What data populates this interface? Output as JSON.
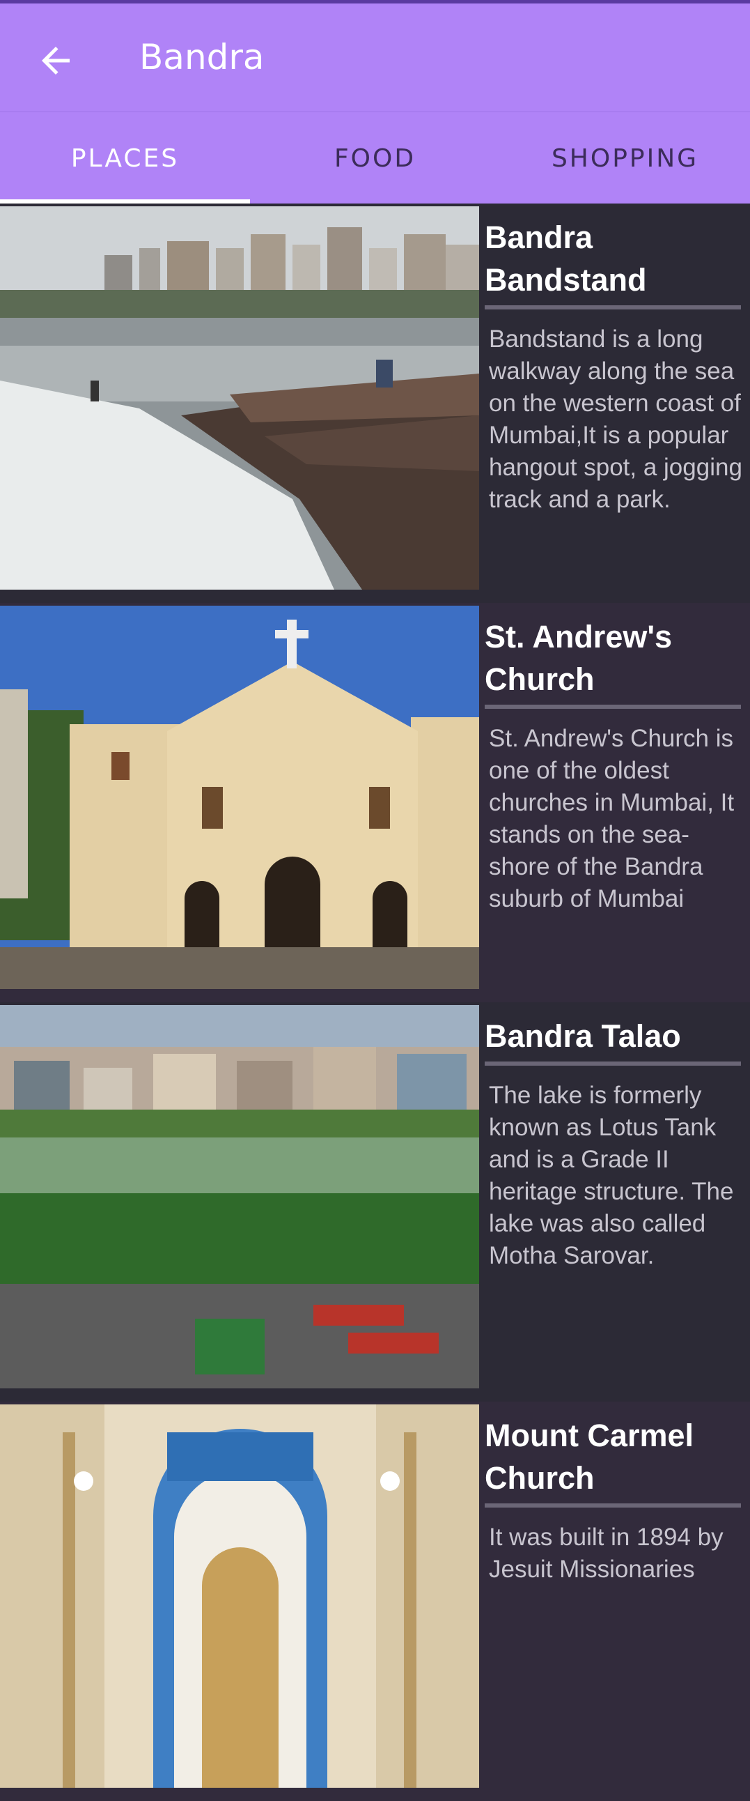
{
  "app_bar": {
    "title": "Bandra",
    "back_icon": "arrow-left-icon"
  },
  "tabs": [
    {
      "label": "PLACES"
    },
    {
      "label": "FOOD"
    },
    {
      "label": "SHOPPING"
    }
  ],
  "places": [
    {
      "name": "Bandra Bandstand",
      "description": "Bandstand is a long walkway along the sea on the western coast of Mumbai,It is a popular hangout spot, a jogging track and a park."
    },
    {
      "name": "St. Andrew's Church",
      "description": "St. Andrew's Church is one of the oldest churches in Mumbai, It stands on the sea-shore of the Bandra suburb of Mumbai"
    },
    {
      "name": "Bandra Talao",
      "description": "The lake is formerly known as Lotus Tank and is a Grade II heritage structure. The lake was also called Motha Sarovar."
    },
    {
      "name": "Mount Carmel Church",
      "description": "It was built in 1894 by Jesuit Missionaries"
    }
  ],
  "colors": {
    "app_bar": "#b083f7",
    "list_bg": "#2c2a36",
    "tab_indicator": "#ffffff"
  }
}
